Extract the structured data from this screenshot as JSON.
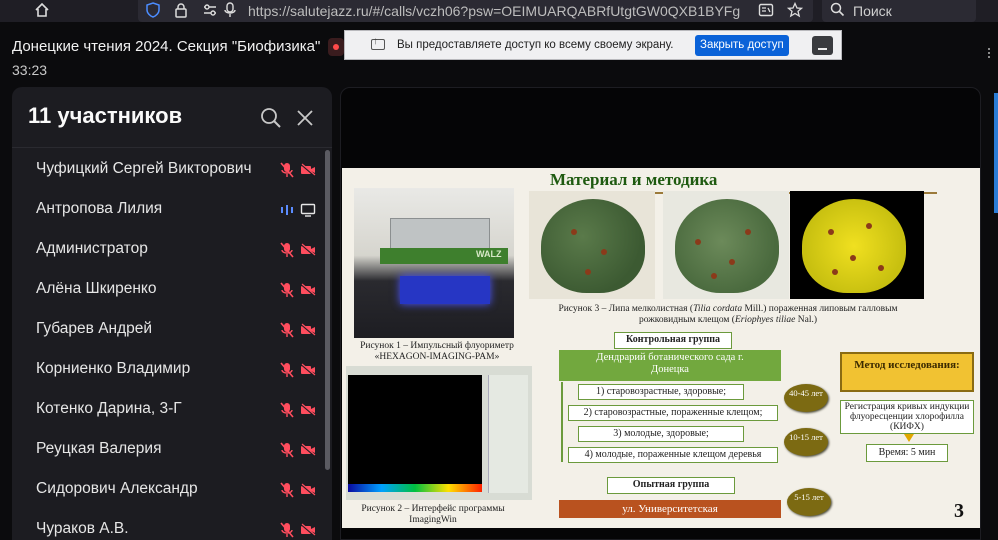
{
  "browser": {
    "url": "https://salutejazz.ru/#/calls/vczh06?psw=OEIMUARQABRfUtgtGW0QXB1BYFg",
    "search_placeholder": "Поиск",
    "icons": [
      "home-icon",
      "shield-icon",
      "lock-icon",
      "permissions-icon",
      "microphone-icon",
      "reader-icon",
      "bookmark-star-icon",
      "search-icon"
    ]
  },
  "call": {
    "title": "Донецкие чтения 2024. Секция \"Биофизика\"",
    "timer": "33:23"
  },
  "share_notice": {
    "text": "Вы предоставляете доступ ко всему своему экрану.",
    "close_label": "Закрыть доступ",
    "accent": "#0a62d8"
  },
  "participants": {
    "title": "11 участников",
    "items": [
      {
        "name": "Чуфицкий Сергей Викторович",
        "mic": "muted",
        "cam": "off"
      },
      {
        "name": "Антропова Лилия",
        "mic": "active",
        "cam": "screen"
      },
      {
        "name": "Администратор",
        "mic": "muted",
        "cam": "off"
      },
      {
        "name": "Алёна Шкиренко",
        "mic": "muted",
        "cam": "off"
      },
      {
        "name": "Губарев Андрей",
        "mic": "muted",
        "cam": "off"
      },
      {
        "name": "Корниенко Владимир",
        "mic": "muted",
        "cam": "off"
      },
      {
        "name": "Котенко Дарина, 3-Г",
        "mic": "muted",
        "cam": "off"
      },
      {
        "name": "Реуцкая Валерия",
        "mic": "muted",
        "cam": "off"
      },
      {
        "name": "Сидорович Александр",
        "mic": "muted",
        "cam": "off"
      },
      {
        "name": "Чураков А.В.",
        "mic": "muted",
        "cam": "off"
      }
    ],
    "muted_color": "#ff4d5e"
  },
  "slide": {
    "title": "Материал и методика",
    "figure1_caption": "Рисунок 1 – Импульсный флуориметр «HEXAGON-IMAGING-PAM»",
    "figure1_label": "WALZ",
    "figure2_caption": "Рисунок 2 – Интерфейс программы ImagingWin",
    "figure3_caption_part1": "Рисунок 3 – Липа мелколистная (",
    "figure3_species": "Tilia cordata",
    "figure3_caption_part2": " Mill.) пораженная липовым галловым",
    "figure3_caption_line2_a": "рожковидным клещом (",
    "figure3_pest": "Eriophyes tiliae",
    "figure3_caption_line2_b": " Nal.)",
    "control_group": "Контрольная группа",
    "dendrarium": "Дендрарий ботанического сада г. Донецка",
    "items": [
      "1) старовозрастные, здоровые;",
      "2) старовозрастные, пораженные клещом;",
      "3) молодые, здоровые;",
      "4) молодые, пораженные клещом деревья"
    ],
    "age1": "40-45 лет",
    "age2": "10-15 лет",
    "age3": "5-15 лет",
    "experimental_group": "Опытная группа",
    "street": "ул. Университетская",
    "method_title": "Метод исследования:",
    "method_desc": "Регистрация кривых индукции флуоресценции хлорофилла (КИФХ)",
    "method_time": "Время: 5 мин",
    "page_number": "3"
  }
}
